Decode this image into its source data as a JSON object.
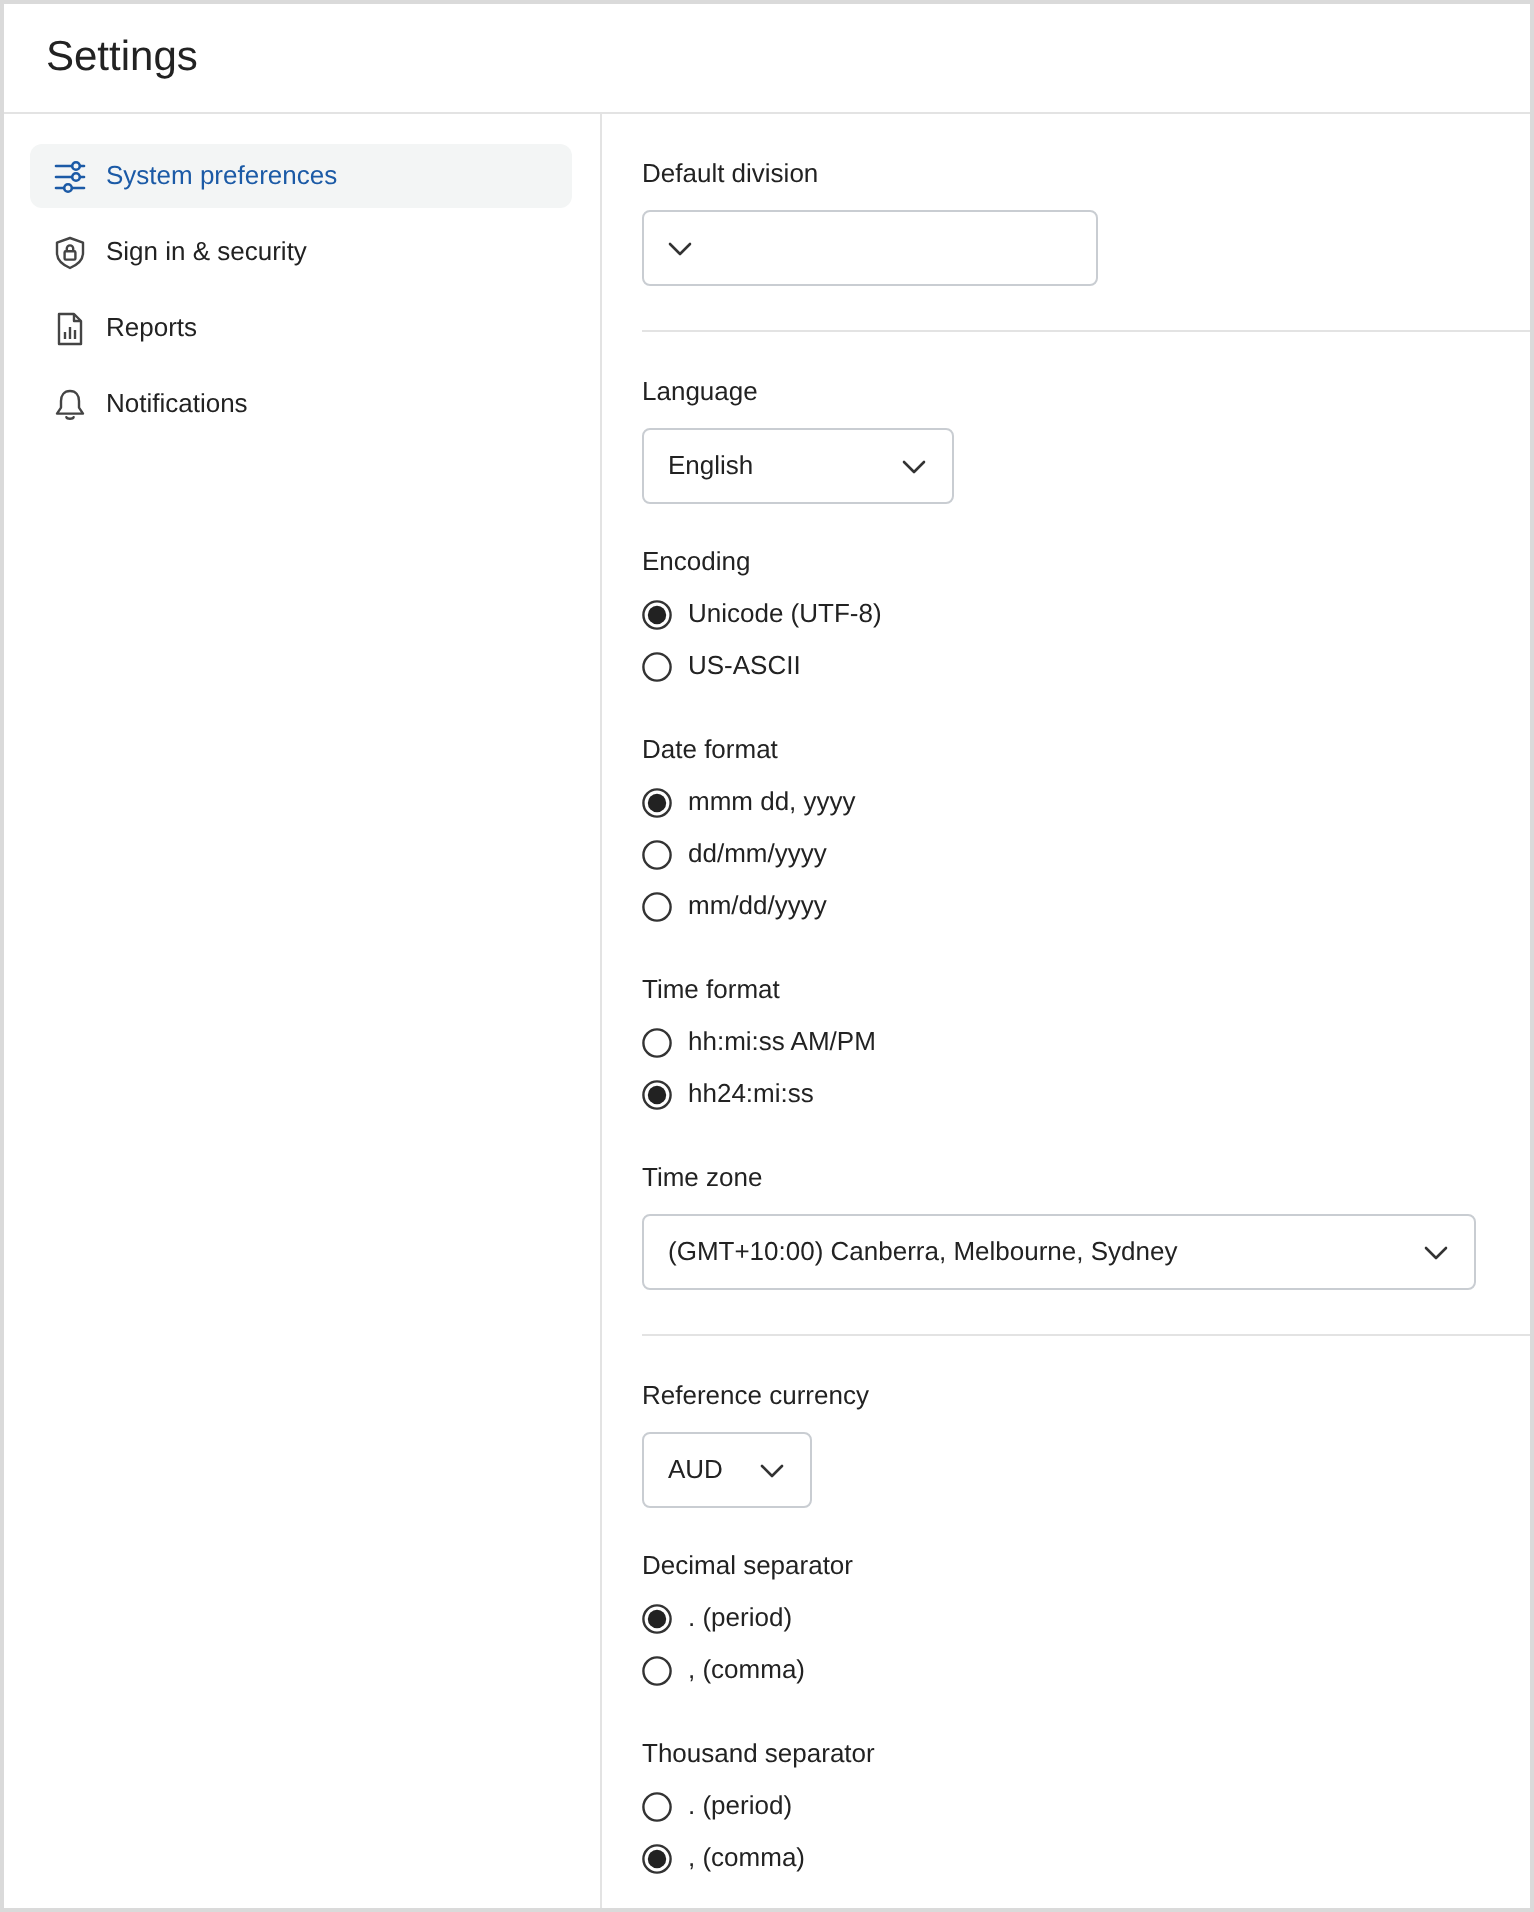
{
  "window": {
    "title": "Settings"
  },
  "sidebar": {
    "items": [
      {
        "label": "System preferences",
        "selected": true
      },
      {
        "label": "Sign in & security",
        "selected": false
      },
      {
        "label": "Reports",
        "selected": false
      },
      {
        "label": "Notifications",
        "selected": false
      }
    ]
  },
  "sections": [
    {
      "fields": [
        {
          "kind": "select",
          "label": "Default division"
        }
      ]
    },
    {
      "fields": [
        {
          "kind": "select",
          "label": "Language",
          "value": "English"
        },
        {
          "kind": "radio",
          "label": "Encoding",
          "options": [
            {
              "label": "Unicode (UTF-8)",
              "selected": true
            },
            {
              "label": "US-ASCII",
              "selected": false
            }
          ]
        },
        {
          "kind": "radio",
          "label": "Date format",
          "options": [
            {
              "label": "mmm dd, yyyy",
              "selected": true
            },
            {
              "label": "dd/mm/yyyy",
              "selected": false
            },
            {
              "label": "mm/dd/yyyy",
              "selected": false
            }
          ]
        },
        {
          "kind": "radio",
          "label": "Time format",
          "options": [
            {
              "label": "hh:mi:ss AM/PM",
              "selected": false
            },
            {
              "label": "hh24:mi:ss",
              "selected": true
            }
          ]
        },
        {
          "kind": "select",
          "label": "Time zone",
          "value": "(GMT+10:00) Canberra, Melbourne, Sydney"
        }
      ]
    },
    {
      "fields": [
        {
          "kind": "select",
          "label": "Reference currency",
          "value": "AUD"
        },
        {
          "kind": "radio",
          "label": "Decimal separator",
          "options": [
            {
              "label": ". (period)",
              "selected": true
            },
            {
              "label": ", (comma)",
              "selected": false
            }
          ]
        },
        {
          "kind": "radio",
          "label": "Thousand separator",
          "options": [
            {
              "label": ". (period)",
              "selected": false
            },
            {
              "label": ", (comma)",
              "selected": true
            }
          ]
        }
      ]
    }
  ]
}
